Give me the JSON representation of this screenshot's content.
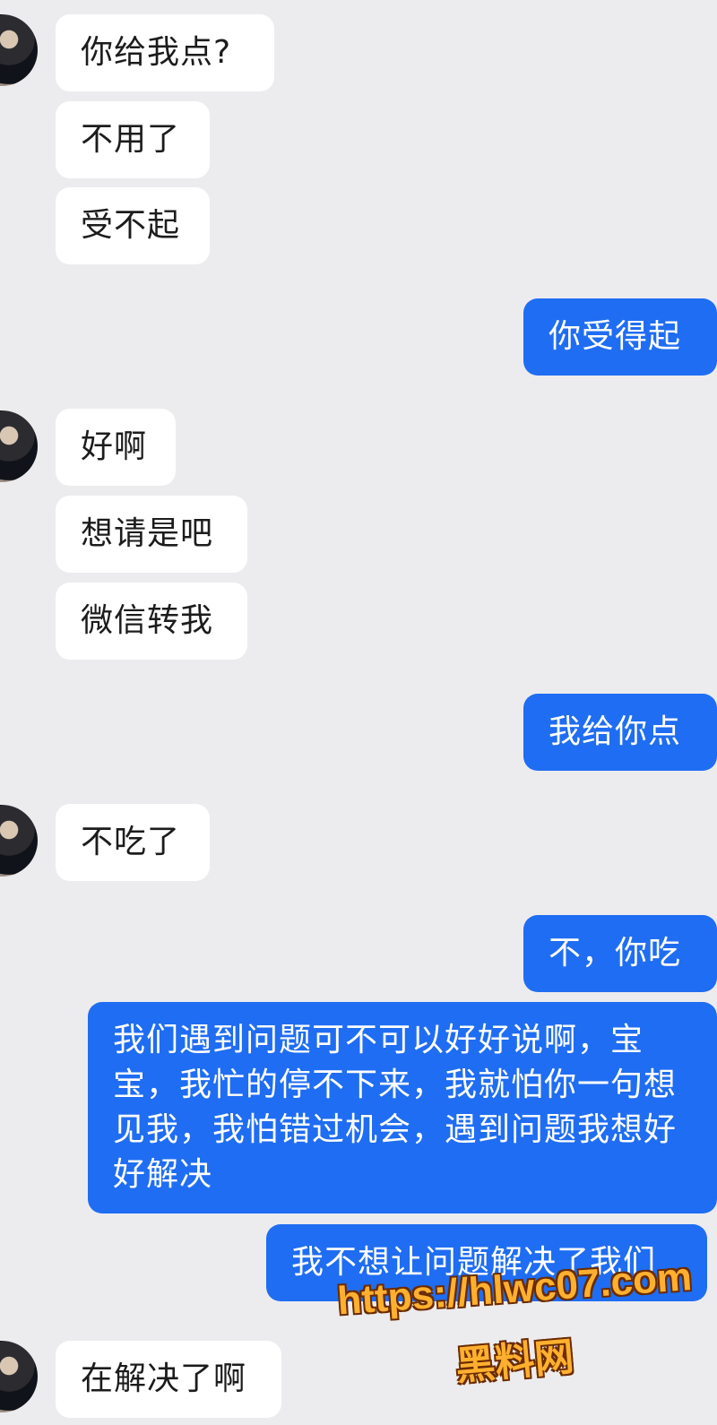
{
  "chat": {
    "messages": [
      {
        "side": "in",
        "text": "你给我点?"
      },
      {
        "side": "in",
        "text": "不用了"
      },
      {
        "side": "in",
        "text": "受不起"
      },
      {
        "side": "out",
        "text": "你受得起"
      },
      {
        "side": "in",
        "text": "好啊"
      },
      {
        "side": "in",
        "text": "想请是吧"
      },
      {
        "side": "in",
        "text": "微信转我"
      },
      {
        "side": "out",
        "text": "我给你点"
      },
      {
        "side": "in",
        "text": "不吃了"
      },
      {
        "side": "out",
        "text": "不，你吃"
      },
      {
        "side": "out",
        "text": "我们遇到问题可不可以好好说啊，宝宝，我忙的停不下来，我就怕你一句想见我，我怕错过机会，遇到问题我想好好解决"
      },
      {
        "side": "out",
        "text": "我不想让问题解决了我们"
      },
      {
        "side": "in",
        "text": "在解决了啊"
      }
    ]
  },
  "watermark": {
    "url": "https://hlwc07.com",
    "label": "黑料网",
    "color": "#ffb02e"
  },
  "theme": {
    "background": "#ececee",
    "incoming_bubble": "#ffffff",
    "outgoing_bubble": "#1f6df2"
  }
}
